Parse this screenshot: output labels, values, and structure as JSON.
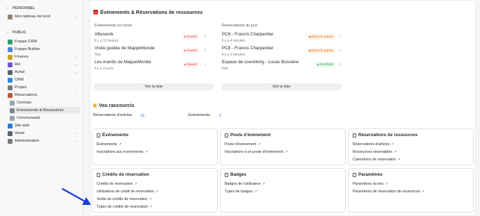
{
  "sidebar": {
    "section_personnel": "PERSONNEL",
    "personnel_items": [
      {
        "label": "Mon tableau de bord",
        "color": "#8a7f73"
      }
    ],
    "section_public": "PUBLIC",
    "public_items": [
      {
        "label": "Frappe CRM",
        "color": "#2e9b6b"
      },
      {
        "label": "Frappe Builder",
        "color": "#4e7fe0"
      },
      {
        "label": "Finance",
        "color": "#d19b20",
        "expandable": true
      },
      {
        "label": "RH",
        "color": "#6a5acd",
        "expandable": true
      },
      {
        "label": "Achat",
        "color": "#5a6270",
        "expandable": true
      },
      {
        "label": "CRM",
        "color": "#2d8bd6"
      },
      {
        "label": "Projets",
        "color": "#7a7a7a"
      },
      {
        "label": "Réservations",
        "color": "#c0573a",
        "expandable": true
      }
    ],
    "reservation_children": [
      {
        "label": "Contrats"
      },
      {
        "label": "Événements & Ressources",
        "active": true
      },
      {
        "label": "Communauté"
      }
    ],
    "tail_items": [
      {
        "label": "Site web",
        "color": "#2a7bd0"
      },
      {
        "label": "Vente",
        "color": "#5a6270",
        "expandable": true
      },
      {
        "label": "Administration",
        "color": "#7a7a7a",
        "expandable": true
      }
    ]
  },
  "main": {
    "title": "Événements & Réservations de ressources",
    "left_col_title": "Événements en cours",
    "right_col_title": "Réservations du jour",
    "events": [
      {
        "title": "Afterwork",
        "sub": "Il y a 12 heures",
        "status": "Ouvert",
        "color": "red"
      },
      {
        "title": "Visite guidée de MappeMonde",
        "sub": "Hier",
        "status": "Ouvert",
        "color": "red"
      },
      {
        "title": "Les mardis de MappeMonde",
        "sub": "Il y a 2 jours",
        "status": "Ouvert",
        "color": "red"
      }
    ],
    "bookings": [
      {
        "title": "PC6 - Francis Charpentier",
        "sub": "Il y a 4 minutes",
        "status": "Dans le panier",
        "color": "orange"
      },
      {
        "title": "PC8 - Francis Charpentier",
        "sub": "Il y a 9 minutes",
        "status": "Dans le panier",
        "color": "orange"
      },
      {
        "title": "Espace de coworking - Lucas Bussière",
        "sub": "Hier",
        "status": "Confirmé",
        "color": "green"
      }
    ],
    "see_list": "Voir la liste",
    "shortcuts_title": "Vos raccourcis",
    "shortcuts": [
      {
        "label": "Réservations d'articles",
        "count": "10"
      },
      {
        "label": "Événements",
        "count": "3"
      }
    ],
    "boxes": [
      {
        "title": "Événements",
        "links": [
          "Événements",
          "Inscriptions aux événements"
        ]
      },
      {
        "title": "Poste d'événement",
        "links": [
          "Poste d'événement",
          "Inscriptions à un poste d'événement"
        ]
      },
      {
        "title": "Réservations de ressources",
        "links": [
          "Réservations d'articles",
          "Ressources réservables",
          "Calendriers de réservation"
        ]
      },
      {
        "title": "Crédits de réservation",
        "links": [
          "Crédits de réservation",
          "Utilisations de crédit de réservation",
          "Solde de crédits de réservation",
          "Types de crédits de réservation"
        ]
      },
      {
        "title": "Badges",
        "links": [
          "Badges de l'utilisateur",
          "Types de badges"
        ]
      },
      {
        "title": "Paramètres",
        "links": [
          "Paramètres du lieu",
          "Paramètres de réservation de ressources"
        ]
      }
    ],
    "link_arrow": "↗"
  },
  "annotation": {
    "color": "#1a3fd6"
  }
}
